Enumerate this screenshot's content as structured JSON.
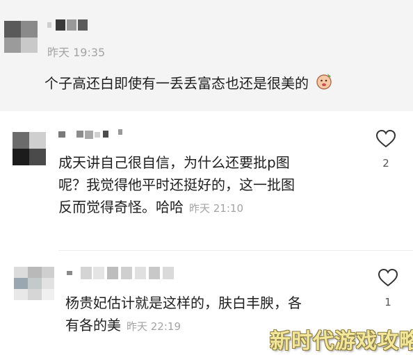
{
  "post": {
    "timestamp": "昨天 19:35",
    "content": "个子高还白即使有一丢丢富态也还是很美的",
    "emoji_icon": "face-with-hand-emoji-icon"
  },
  "comments": [
    {
      "content_lines": [
        "成天讲自己很自信，为什么还要批p图",
        "呢？我觉得他平时还挺好的，这一批图",
        "反而觉得奇怪。哈哈"
      ],
      "timestamp": "昨天 21:10",
      "likes": "2"
    },
    {
      "content_lines": [
        "杨贵妃估计就是这样的，肤白丰腴，各",
        "有各的美"
      ],
      "timestamp": "昨天 22:19",
      "likes": "1"
    }
  ],
  "watermark": "新时代游戏攻略",
  "colors": {
    "card_bg": "#f4f4f4",
    "muted_text": "#a3a3a3",
    "watermark": "#f2e79a"
  }
}
